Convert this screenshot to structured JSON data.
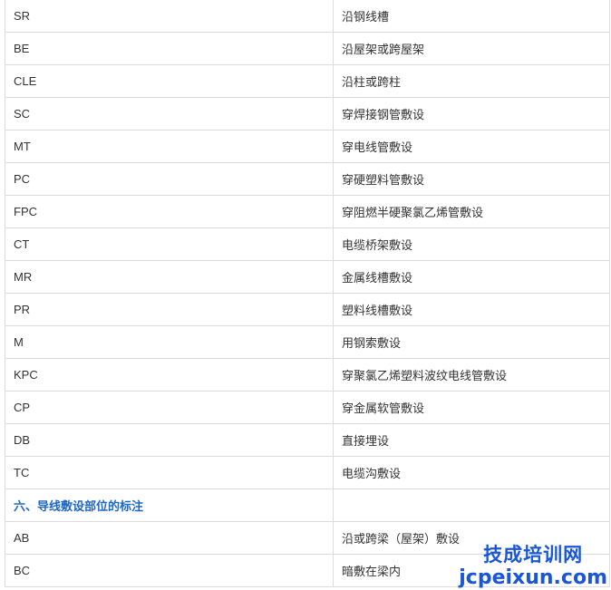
{
  "table": {
    "rows": [
      {
        "code": "SR",
        "desc": "沿钢线槽"
      },
      {
        "code": "BE",
        "desc": "沿屋架或跨屋架"
      },
      {
        "code": "CLE",
        "desc": "沿柱或跨柱"
      },
      {
        "code": "SC",
        "desc": "穿焊接钢管敷设"
      },
      {
        "code": "MT",
        "desc": "穿电线管敷设"
      },
      {
        "code": "PC",
        "desc": "穿硬塑料管敷设"
      },
      {
        "code": "FPC",
        "desc": "穿阻燃半硬聚氯乙烯管敷设"
      },
      {
        "code": "CT",
        "desc": "电缆桥架敷设"
      },
      {
        "code": "MR",
        "desc": "金属线槽敷设"
      },
      {
        "code": "PR",
        "desc": "塑料线槽敷设"
      },
      {
        "code": "M",
        "desc": "用钢索敷设"
      },
      {
        "code": "KPC",
        "desc": "穿聚氯乙烯塑料波纹电线管敷设"
      },
      {
        "code": "CP",
        "desc": "穿金属软管敷设"
      },
      {
        "code": "DB",
        "desc": "直接埋设"
      },
      {
        "code": "TC",
        "desc": "电缆沟敷设"
      }
    ],
    "section_heading": "六、导线敷设部位的标注",
    "section_rows": [
      {
        "code": "AB",
        "desc": "沿或跨梁（屋架）敷设"
      },
      {
        "code": "BC",
        "desc": "暗敷在梁内"
      }
    ]
  },
  "watermark": {
    "chinese": "技成培训网",
    "url": "jcpeixun.com"
  },
  "colors": {
    "section_heading": "#1f66c9",
    "watermark": "#1a56d8",
    "border": "#dcdcdc",
    "text": "#333333"
  }
}
